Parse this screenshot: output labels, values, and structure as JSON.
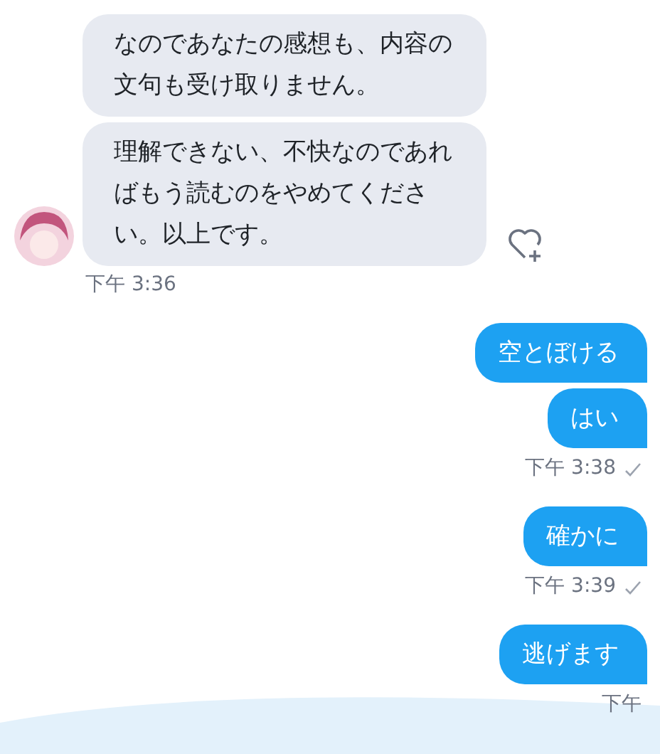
{
  "messages": [
    {
      "kind": "received",
      "bubbles": [
        "なのであなたの感想も、内容の文句も受け取りません。",
        "理解できない、不快なのであればもう読むのをやめてください。以上です。"
      ],
      "time": "下午 3:36"
    },
    {
      "kind": "sent",
      "bubbles": [
        "空とぼける",
        "はい"
      ],
      "time": "下午 3:38",
      "delivered": true
    },
    {
      "kind": "sent",
      "bubbles": [
        "確かに"
      ],
      "time": "下午 3:39",
      "delivered": true
    },
    {
      "kind": "sent",
      "bubbles": [
        "逃げます"
      ],
      "time": "下午",
      "delivered": false
    }
  ]
}
